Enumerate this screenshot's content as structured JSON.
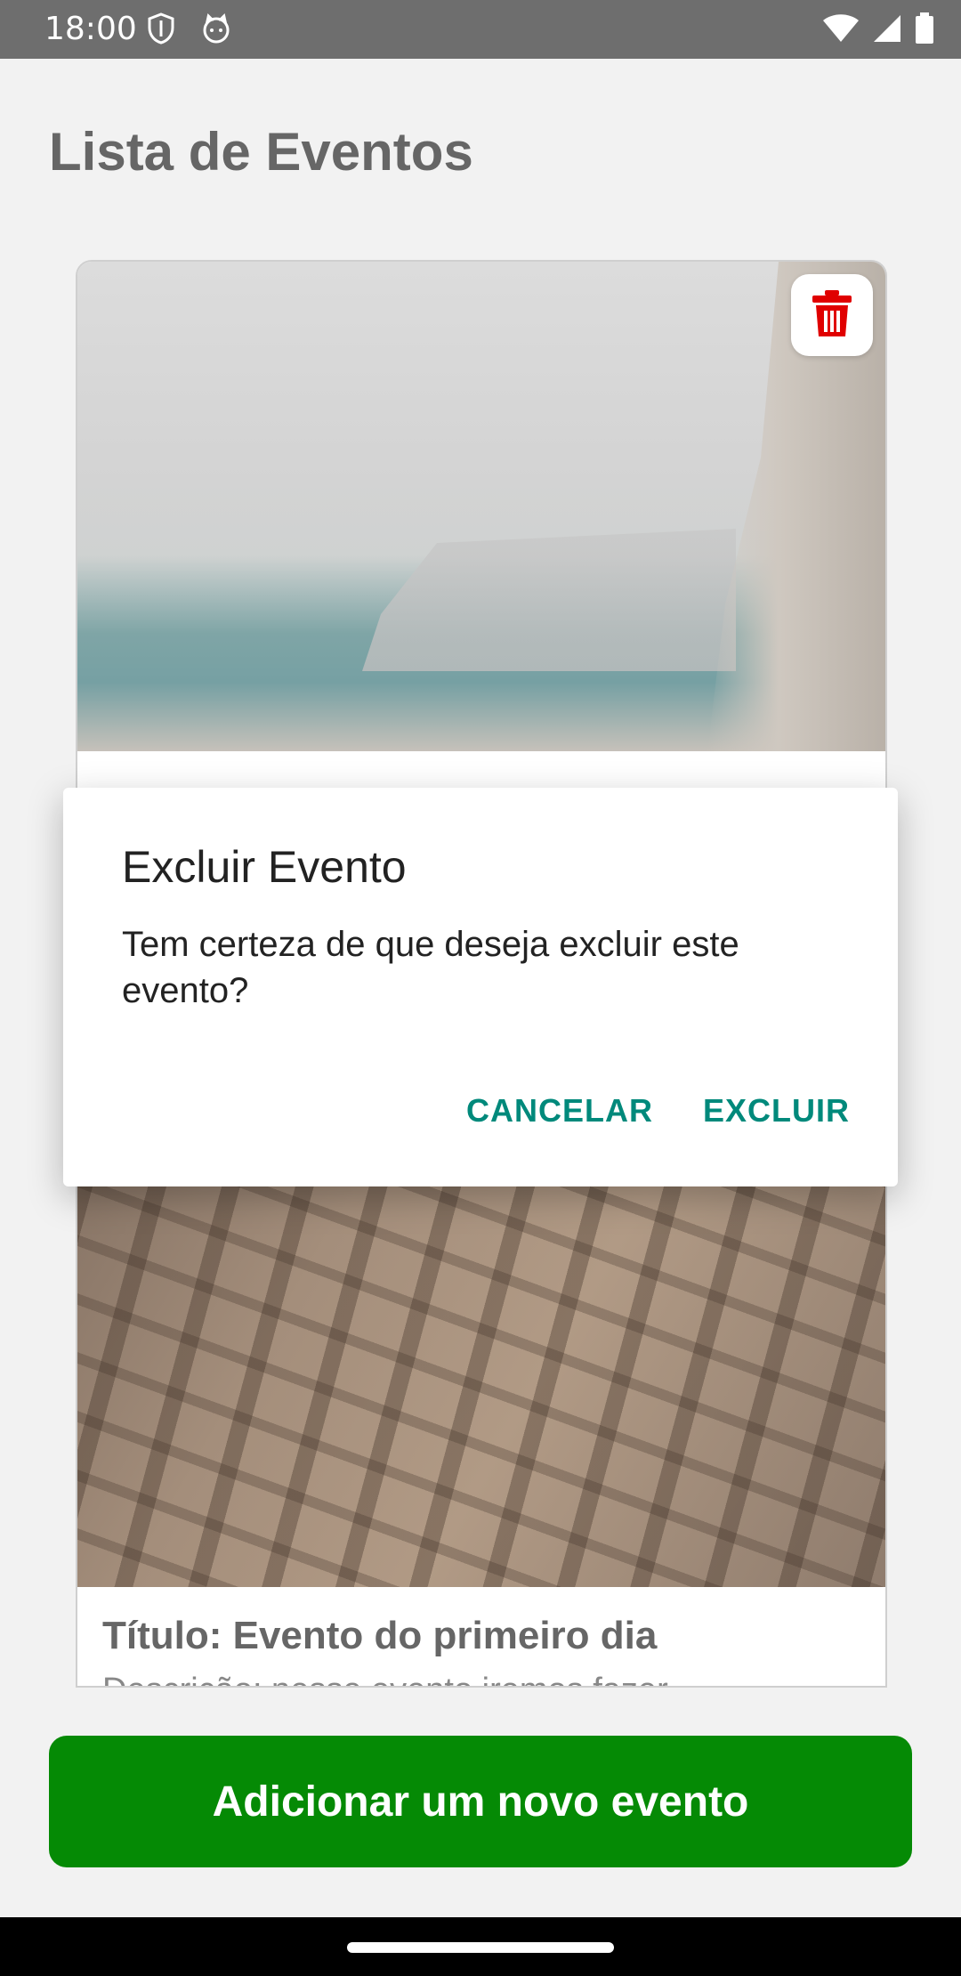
{
  "status_bar": {
    "time": "18:00",
    "left_icons": [
      "shield-icon",
      "cat-icon"
    ],
    "right_icons": [
      "wifi-icon",
      "signal-icon",
      "battery-icon"
    ]
  },
  "page": {
    "title": "Lista de Eventos"
  },
  "events": [
    {
      "image": "sea-cliff-photo",
      "action_icon": "trash-icon"
    },
    {
      "image": "building-photo",
      "title": "Título: Evento do primeiro dia",
      "description": "Descrição: nesse evento iremos fazer..."
    }
  ],
  "dialog": {
    "title": "Excluir Evento",
    "message": "Tem certeza de que deseja excluir este evento?",
    "cancel_label": "CANCELAR",
    "confirm_label": "EXCLUIR"
  },
  "footer": {
    "add_button_label": "Adicionar um novo evento"
  },
  "colors": {
    "accent_dialog_buttons": "#00897b",
    "add_button_bg": "#058a05",
    "trash_icon": "#e00000",
    "status_bar_bg": "#6e6e6e"
  }
}
